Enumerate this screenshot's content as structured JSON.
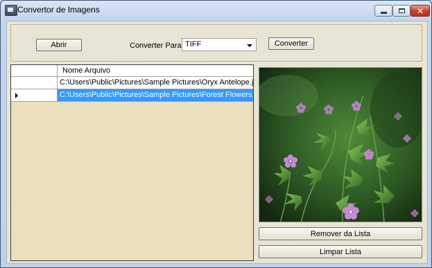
{
  "window": {
    "title": "Convertor de Imagens",
    "controls": {
      "minimize_icon": "minimize-icon",
      "maximize_icon": "maximize-icon",
      "close_icon": "close-icon",
      "close_glyph": "✕"
    }
  },
  "toolbar": {
    "open_label": "Abrir",
    "convert_to_label": "Converter Para",
    "format": {
      "selected": "TIFF"
    },
    "convert_label": "Converter"
  },
  "grid": {
    "column_header": "Nome Arquivo",
    "rows": [
      {
        "file": "C:\\Users\\Public\\Pictures\\Sample Pictures\\Oryx Antelope.jpg",
        "selected": false
      },
      {
        "file": "C:\\Users\\Public\\Pictures\\Sample Pictures\\Forest Flowers.jpg",
        "selected": true
      }
    ]
  },
  "preview": {
    "subject": "forest-flowers-photo"
  },
  "actions": {
    "remove_label": "Remover da Lista",
    "clear_label": "Limpar Lista"
  },
  "colors": {
    "selection": "#3399ff",
    "grid_background": "#ece0bf",
    "close_button": "#c9462c"
  }
}
